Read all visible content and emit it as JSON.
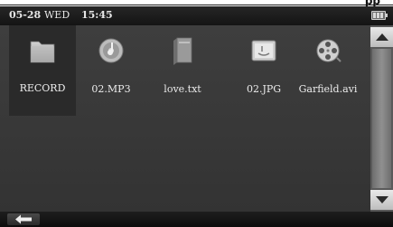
{
  "status_bar": {
    "date": "05-28",
    "day": "WED",
    "time": "15:45",
    "battery_icon": "battery-icon"
  },
  "top_fragment": "pp",
  "files": [
    {
      "name": "RECORD",
      "icon": "folder-icon",
      "selected": true
    },
    {
      "name": "02.MP3",
      "icon": "music-file-icon",
      "selected": false
    },
    {
      "name": "love.txt",
      "icon": "text-file-icon",
      "selected": false
    },
    {
      "name": "02.JPG",
      "icon": "image-file-icon",
      "selected": false
    },
    {
      "name": "Garfield.avi",
      "icon": "video-file-icon",
      "selected": false
    }
  ],
  "scrollbar": {
    "up_icon": "arrow-up-icon",
    "down_icon": "arrow-down-icon"
  },
  "bottom_bar": {
    "back_icon": "back-arrow-icon"
  },
  "colors": {
    "screen_bg": "#3a3a3a",
    "status_bg": "#1a1a1a",
    "text": "#ececec",
    "scroll_button": "#d6d6d6"
  }
}
